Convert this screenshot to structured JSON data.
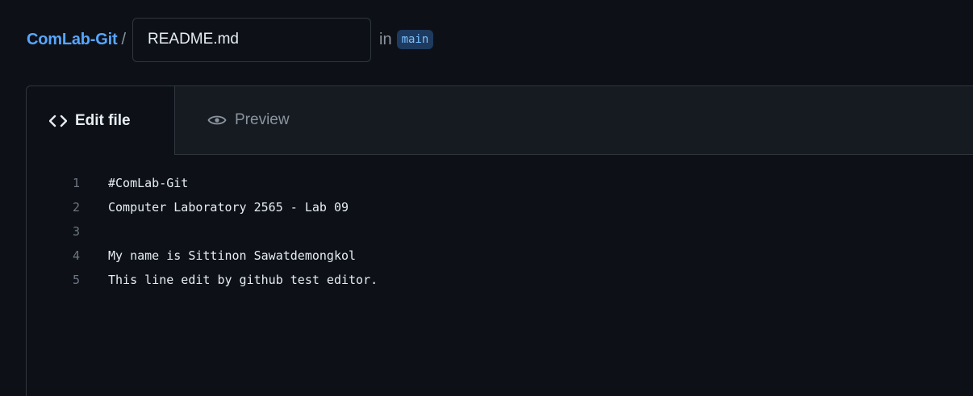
{
  "header": {
    "repo_name": "ComLab-Git",
    "separator": "/",
    "filename_value": "README.md",
    "in_text": "in",
    "branch": "main"
  },
  "tabs": {
    "edit": {
      "label": "Edit file",
      "icon": "code-icon"
    },
    "preview": {
      "label": "Preview",
      "icon": "eye-icon"
    }
  },
  "editor": {
    "lines": [
      {
        "number": "1",
        "text": "#ComLab-Git"
      },
      {
        "number": "2",
        "text": "Computer Laboratory 2565 - Lab 09"
      },
      {
        "number": "3",
        "text": ""
      },
      {
        "number": "4",
        "text": "My name is Sittinon Sawatdemongkol"
      },
      {
        "number": "5",
        "text": "This line edit by github test editor."
      }
    ]
  },
  "colors": {
    "background": "#0d1117",
    "accent": "#58a6ff",
    "border": "#30363d",
    "text": "#e6edf3",
    "muted": "#8b949e",
    "branch_badge_bg": "#1f3a5f"
  }
}
